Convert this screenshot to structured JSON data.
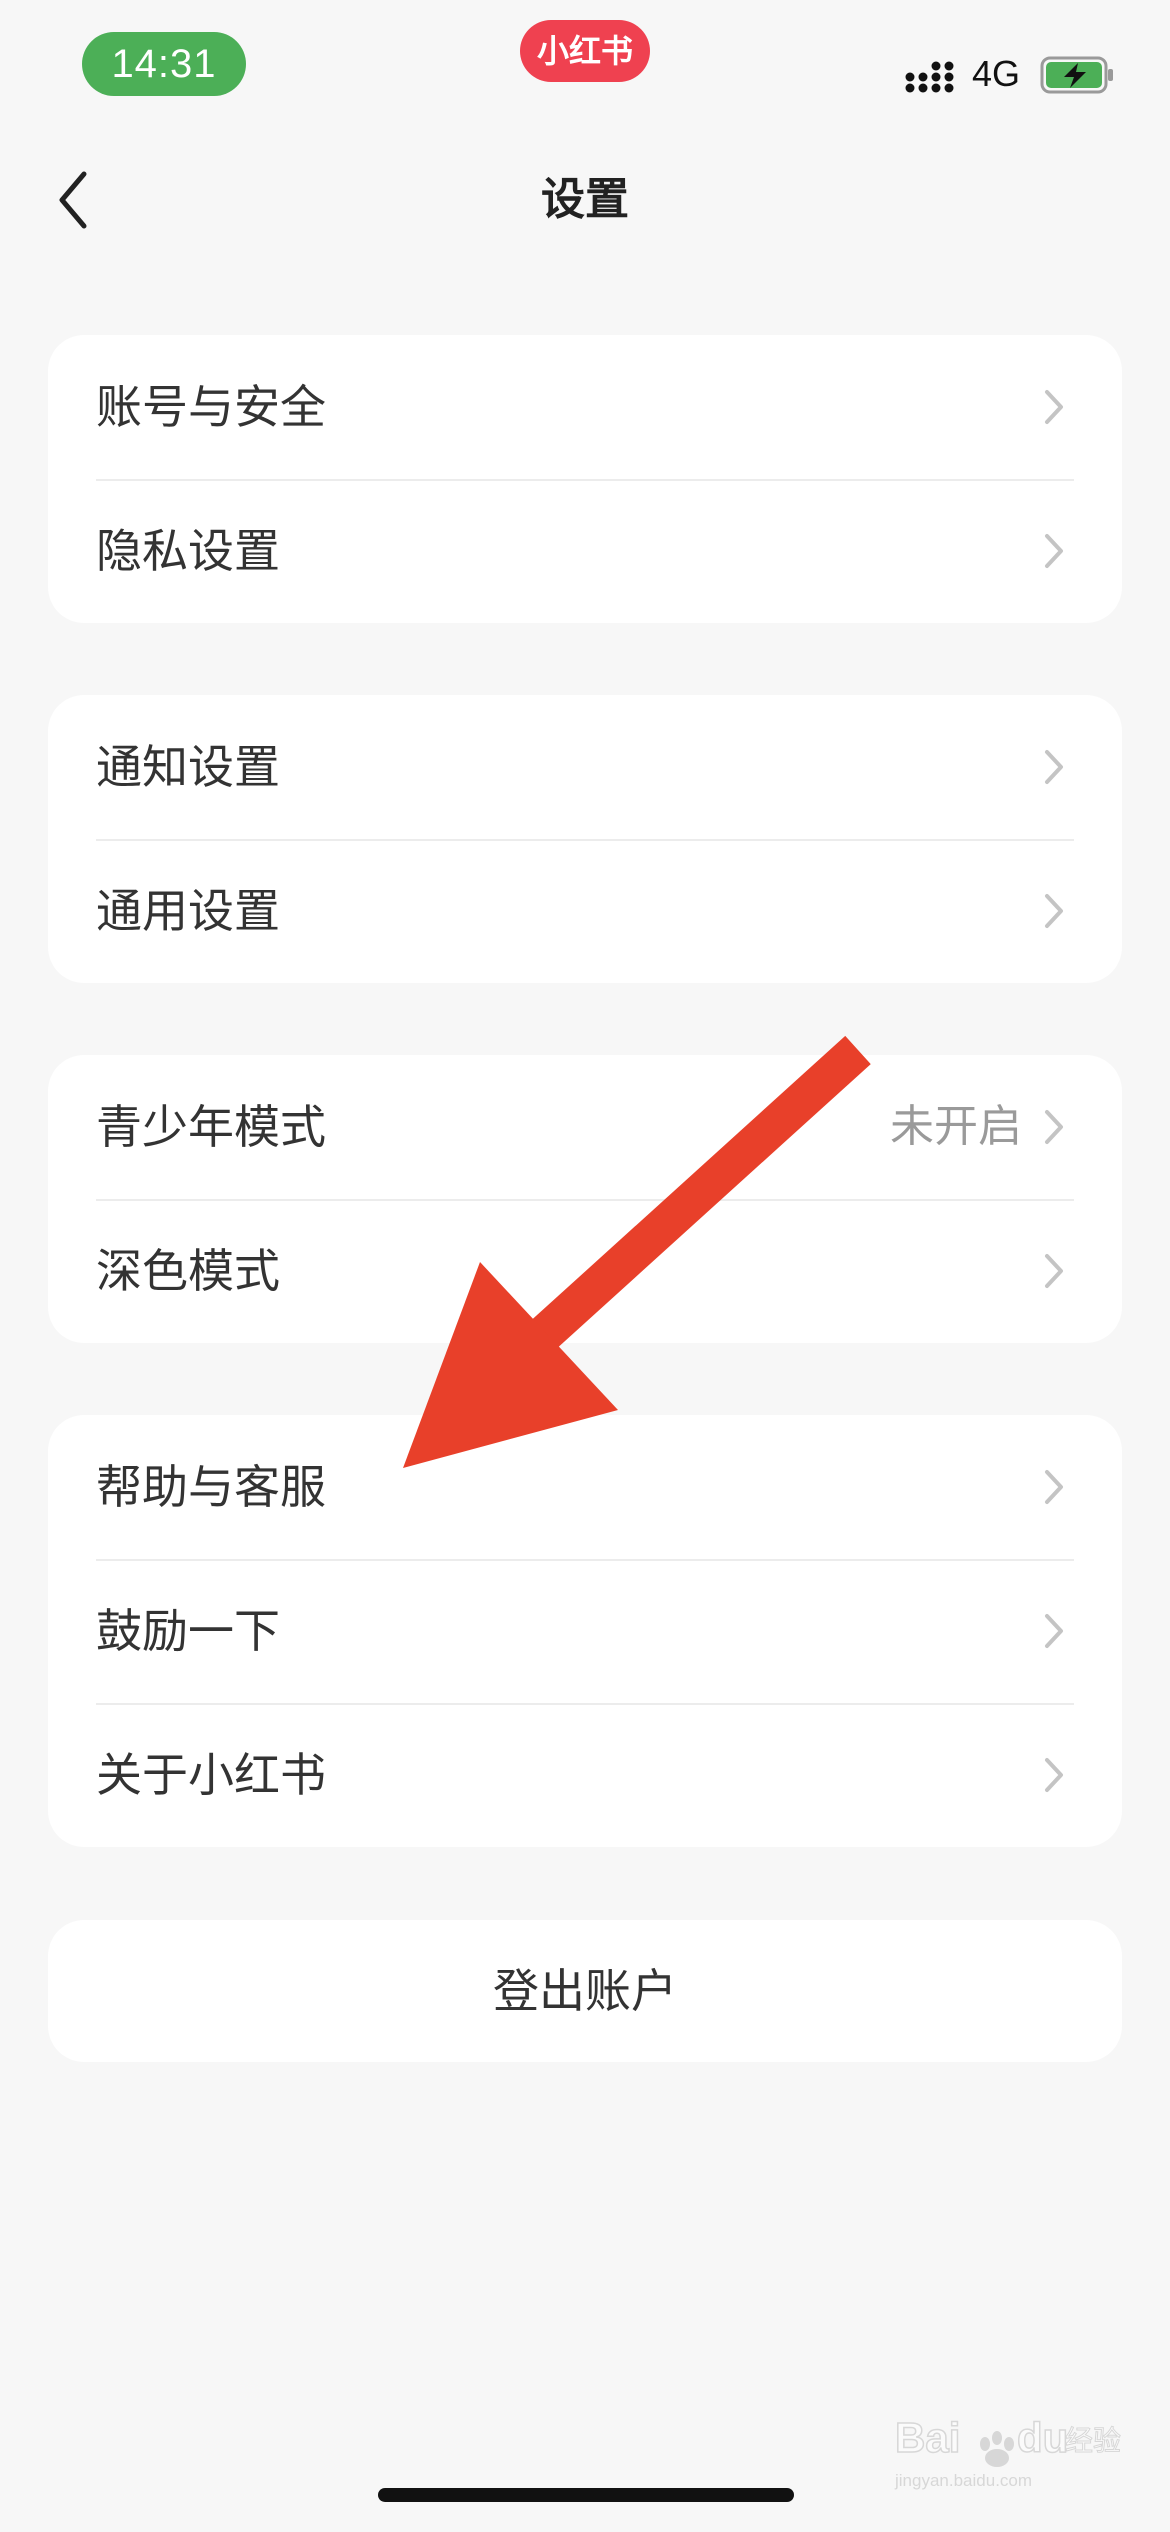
{
  "status_bar": {
    "time": "14:31",
    "app_badge": "小红书",
    "network": "4G",
    "colors": {
      "time_pill": "#4caf57",
      "app_badge": "#ef4150",
      "battery": "#4caf57"
    }
  },
  "nav": {
    "title": "设置",
    "back_icon": "chevron-left-icon"
  },
  "groups": [
    {
      "items": [
        {
          "label": "账号与安全",
          "value": ""
        },
        {
          "label": "隐私设置",
          "value": ""
        }
      ]
    },
    {
      "items": [
        {
          "label": "通知设置",
          "value": ""
        },
        {
          "label": "通用设置",
          "value": ""
        }
      ]
    },
    {
      "items": [
        {
          "label": "青少年模式",
          "value": "未开启"
        },
        {
          "label": "深色模式",
          "value": ""
        }
      ]
    },
    {
      "items": [
        {
          "label": "帮助与客服",
          "value": ""
        },
        {
          "label": "鼓励一下",
          "value": ""
        },
        {
          "label": "关于小红书",
          "value": ""
        }
      ]
    }
  ],
  "logout": {
    "label": "登出账户"
  },
  "annotation": {
    "type": "arrow",
    "color": "#e8402a",
    "points_to": "帮助与客服"
  },
  "watermark": {
    "text": "Baidu经验",
    "subtext": "jingyan.baidu.com"
  }
}
